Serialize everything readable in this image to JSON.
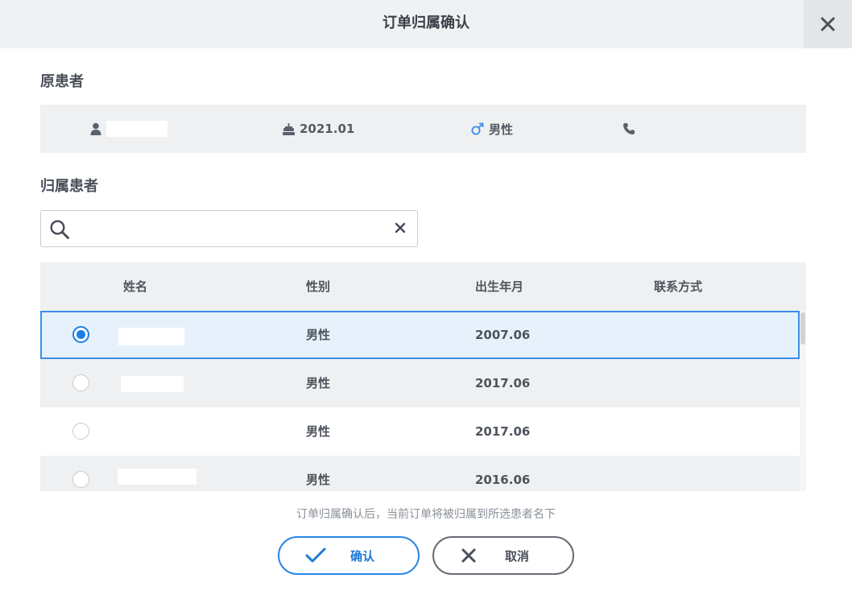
{
  "dialog": {
    "title": "订单归属确认",
    "close_icon": "close-icon"
  },
  "original": {
    "section_title": "原患者",
    "birth": "2021.01",
    "gender": "男性",
    "icons": [
      "user-icon",
      "cake-icon",
      "male-icon",
      "phone-icon"
    ]
  },
  "target": {
    "section_title": "归属患者",
    "search": {
      "value": "",
      "placeholder": ""
    }
  },
  "table": {
    "headers": {
      "name": "姓名",
      "gender": "性别",
      "birth": "出生年月",
      "contact": "联系方式"
    },
    "rows": [
      {
        "gender": "男性",
        "birth": "2007.06",
        "selected": true
      },
      {
        "gender": "男性",
        "birth": "2017.06",
        "selected": false
      },
      {
        "gender": "男性",
        "birth": "2017.06",
        "selected": false
      },
      {
        "gender": "男性",
        "birth": "2016.06",
        "selected": false
      }
    ]
  },
  "note": "订单归属确认后，当前订单将被归属到所选患者名下",
  "buttons": {
    "confirm": "确认",
    "cancel": "取消"
  },
  "colors": {
    "accent": "#1d7fe6",
    "selected_row_bg": "#e6f1fc",
    "male_icon": "#3a8ee6"
  }
}
